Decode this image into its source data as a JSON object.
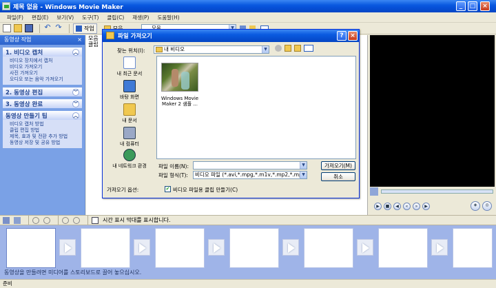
{
  "window": {
    "title": "제목 없음 - Windows Movie Maker",
    "min": "_",
    "max": "□",
    "close": "×"
  },
  "menu": [
    "파일(F)",
    "편집(E)",
    "보기(V)",
    "도구(T)",
    "클립(C)",
    "재생(P)",
    "도움말(H)"
  ],
  "toolbar": {
    "tasks_label": "작업",
    "collections_label": "모음",
    "collection_value": "모음"
  },
  "taskpane": {
    "header": "동영상 작업",
    "sections": [
      {
        "title": "1. 비디오 캡처",
        "links": [
          "비디오 장치에서 캡처",
          "비디오 가져오기",
          "사진 가져오기",
          "오디오 또는 음악 가져오기"
        ]
      },
      {
        "title": "2. 동영상 편집",
        "links": []
      },
      {
        "title": "3. 동영상 완료",
        "links": []
      },
      {
        "title": "동영상 만들기 팁",
        "links": [
          "비디오 캡처 방법",
          "클립 편집 방법",
          "제목, 효과 및 전환 추가 방법",
          "동영상 저장 및 공유 방법"
        ]
      }
    ]
  },
  "collection": {
    "line1": "모음",
    "line2": "클립"
  },
  "storyboard": {
    "timeline_label": "시간 표시 막대를 표시합니다.",
    "hint": "동영상을 만들려면 미디어를 스토리보드로 끌어 놓으십시오."
  },
  "status": "준비",
  "dialog": {
    "title": "파일 가져오기",
    "look_in_label": "찾는 위치(I):",
    "look_in_value": "내 비디오",
    "places": [
      "내 최근 문서",
      "바탕 화면",
      "내 문서",
      "내 컴퓨터",
      "내 네트워크 환경"
    ],
    "file": {
      "name": "Windows Movie Maker 2 샘플 ..."
    },
    "filename_label": "파일 이름(N):",
    "filename_value": "",
    "filetype_label": "파일 형식(T):",
    "filetype_value": "비디오 파일 (*.avi,*.mpg,*.m1v,*.mp2,*.mp2v,",
    "import_button": "가져오기(M)",
    "cancel_button": "취소",
    "options_label": "가져오기 옵션:",
    "create_clips_label": "비디오 파일용 클립 만들기(C)",
    "create_clips_checked": true
  }
}
